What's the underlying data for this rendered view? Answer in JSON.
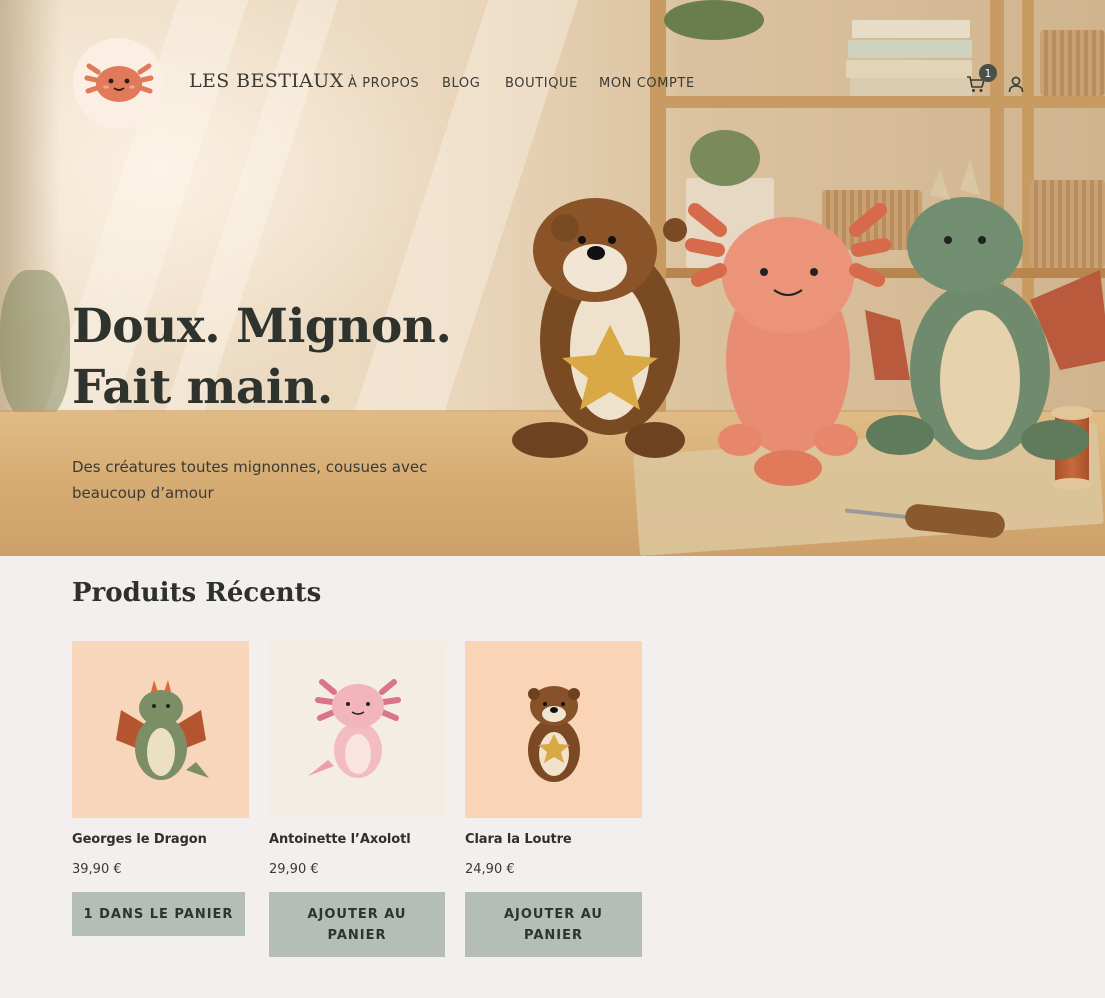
{
  "header": {
    "brand": "LES BESTIAUX",
    "logo_icon": "axolotl-logo-icon",
    "nav": [
      "À PROPOS",
      "BLOG",
      "BOUTIQUE",
      "MON COMPTE"
    ],
    "cart_icon": "cart-icon",
    "cart_count": "1",
    "account_icon": "user-icon"
  },
  "hero": {
    "headline_line1": "Doux. Mignon.",
    "headline_line2": "Fait main.",
    "tagline": "Des créatures toutes mignonnes, cousues avec beaucoup d’amour"
  },
  "products": {
    "title": "Produits Récents",
    "items": [
      {
        "name": "Georges le Dragon",
        "price": "39,90 €",
        "button": "1 DANS LE PANIER"
      },
      {
        "name": "Antoinette l’Axolotl",
        "price": "29,90 €",
        "button": "AJOUTER AU PANIER"
      },
      {
        "name": "Clara la Loutre",
        "price": "24,90 €",
        "button": "AJOUTER AU PANIER"
      }
    ]
  },
  "colors": {
    "page_bg": "#f3efee",
    "button_bg": "#b4beb6",
    "text": "#2e302b",
    "accent_axolotl": "#e07a5a"
  }
}
